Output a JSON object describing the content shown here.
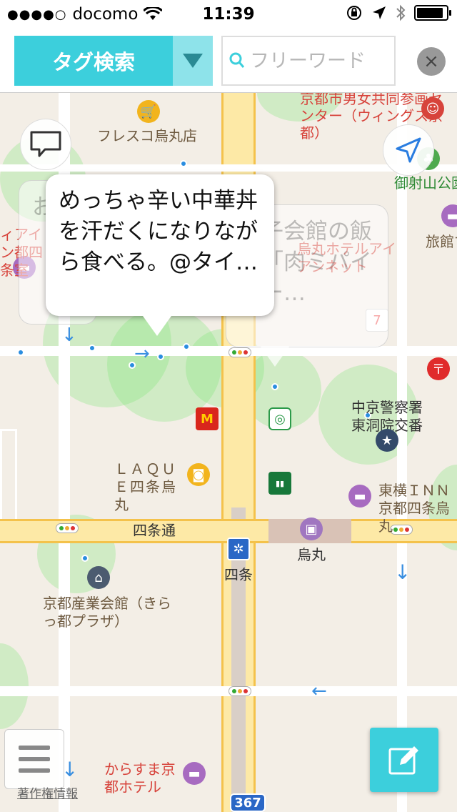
{
  "status": {
    "carrier": "docomo",
    "signal_dots": "●●●●○",
    "time": "11:39"
  },
  "toolbar": {
    "tag_search_label": "タグ検索",
    "search_placeholder": "フリーワード",
    "clear_label": "×"
  },
  "callouts": {
    "front_text": "めっちゃ辛い中華丼を汗だくになりながら食べる。@タイ…",
    "right_text": "餃子会館の飯は「肉ミパイシー…",
    "left_text": "お"
  },
  "map_labels": {
    "fresco": "フレスコ烏丸店",
    "gender_center": "京都市男女共同参画センター（ウィングス京都）",
    "goshayama": "御射山公園",
    "ryokan": "旅館す",
    "inn_left": "ィアイン都四条室",
    "hotel_faded": "烏丸ホテルアイアンネット",
    "police": "中京警察署東洞院交番",
    "laque": "ＬＡＱＵＥ四条烏丸",
    "toyoko": "東横ＩＮＮ京都四条烏丸",
    "shijo_dori": "四条通",
    "shijo_station": "四条",
    "karasuma": "烏丸",
    "sangyo": "京都産業会館（きらっ都プラザ）",
    "karasuma_hotel": "からすま京都ホテル",
    "route_no": "367"
  },
  "bottom": {
    "copyright": "著作権情報"
  },
  "colors": {
    "accent": "#3ccfdc",
    "accent_light": "#8ee3ea"
  }
}
